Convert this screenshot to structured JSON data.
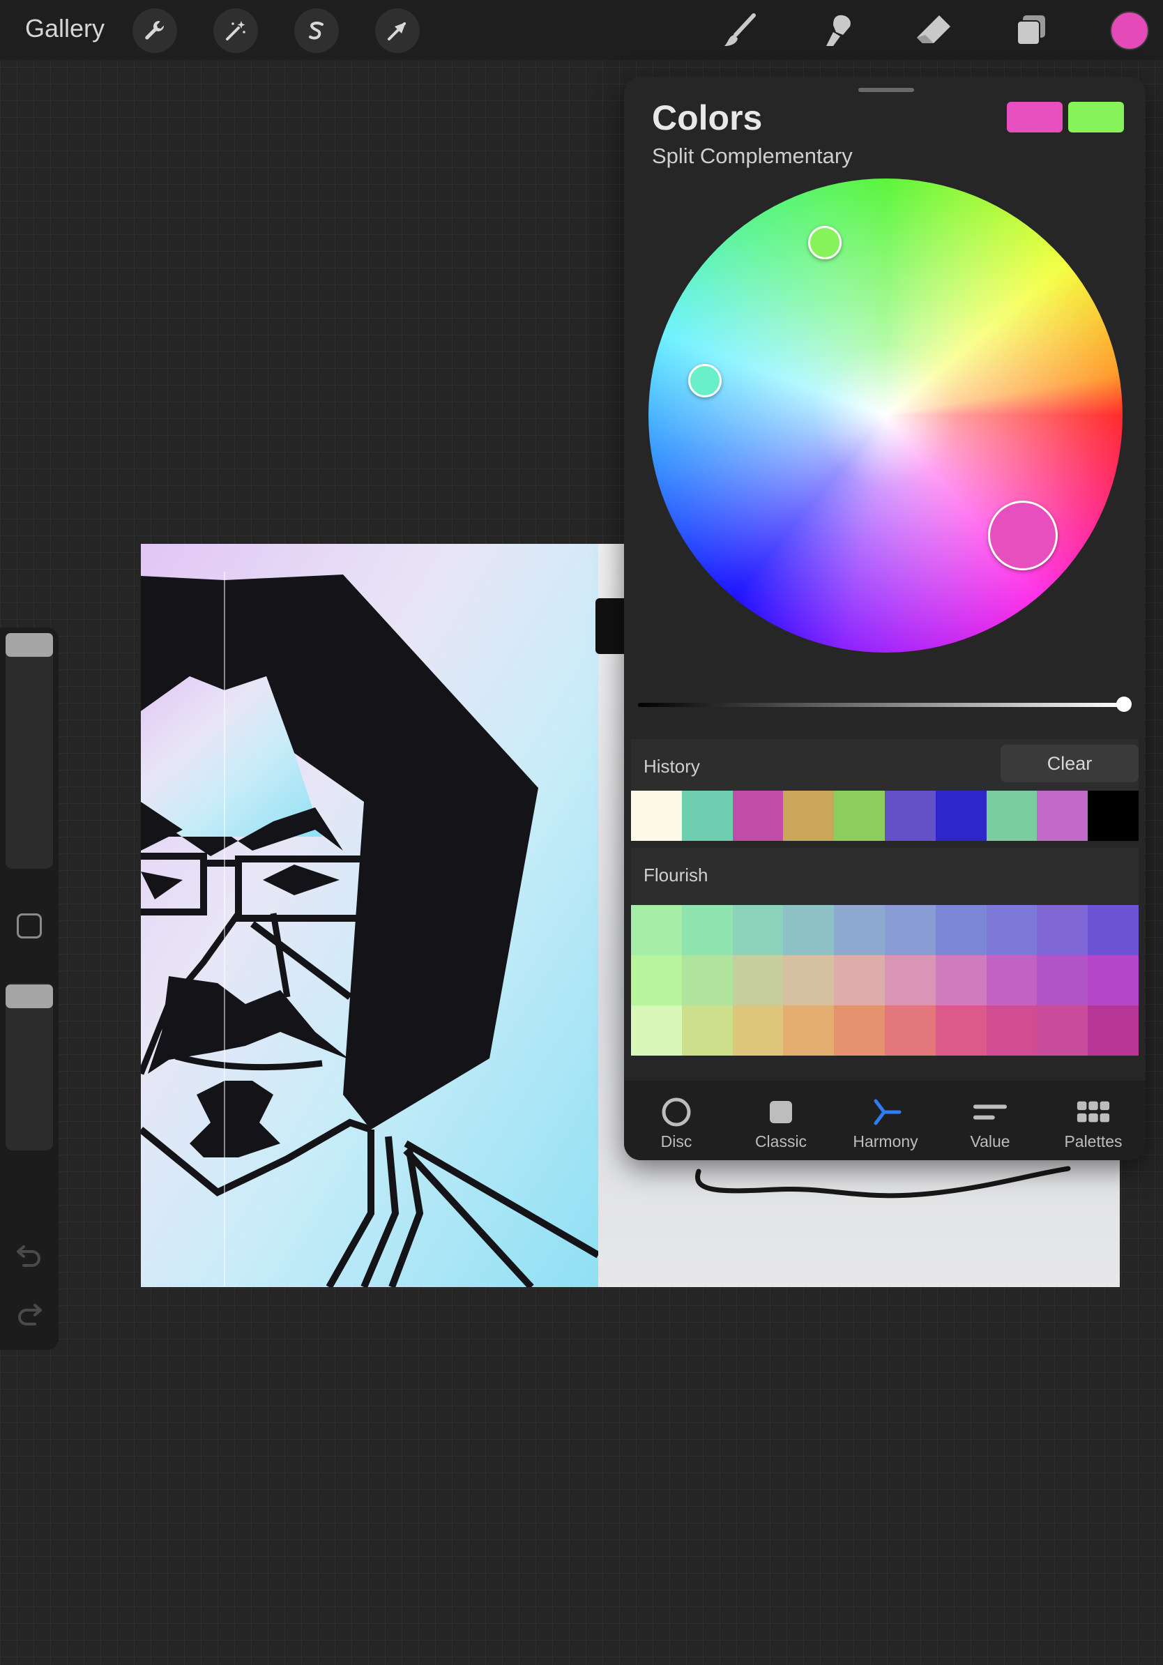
{
  "topbar": {
    "gallery_label": "Gallery",
    "icons": [
      "wrench-icon",
      "magic-wand-icon",
      "selection-s-icon",
      "arrow-transform-icon"
    ],
    "tools": [
      "brush-icon",
      "smudge-icon",
      "eraser-icon",
      "layers-icon"
    ],
    "current_color": "#e44ab8"
  },
  "sidebar": {
    "size_slider_level": 0.0,
    "opacity_slider_level": 0.0
  },
  "colors_panel": {
    "title": "Colors",
    "harmony_mode": "Split Complementary",
    "primary_color": "#e84fbe",
    "secondary_color": "#86f35a",
    "harmony_points": [
      "#e84fbe",
      "#86f35a",
      "#69f0c8"
    ],
    "brightness_level": 1.0,
    "history": {
      "label": "History",
      "clear_label": "Clear",
      "colors": [
        "#fcf9e6",
        "#6dcfb0",
        "#c04ea9",
        "#c9a65a",
        "#8dcd5b",
        "#6451c8",
        "#2d26c8",
        "#79cda0",
        "#c26ac9",
        "#000000"
      ]
    },
    "palette": {
      "label": "Flourish",
      "rows": [
        [
          "#a6eea8",
          "#90e4b0",
          "#8dd2ba",
          "#8ec2c6",
          "#8eaad0",
          "#8a9cd4",
          "#7d87d8",
          "#7c79d8",
          "#7f68d6",
          "#6d54d4"
        ],
        [
          "#b8f49c",
          "#b0e49c",
          "#c6cd9e",
          "#d6c0a2",
          "#dcadab",
          "#d995b5",
          "#cf7bbe",
          "#c262c5",
          "#b154c8",
          "#b447c9"
        ],
        [
          "#d9f7b8",
          "#cedf8c",
          "#ddc57a",
          "#e3ae70",
          "#e5926e",
          "#e2787c",
          "#dc5a8a",
          "#d24c92",
          "#c94b9c",
          "#b83796"
        ]
      ]
    },
    "tabs": [
      {
        "label": "Disc",
        "icon": "disc-icon",
        "active": false
      },
      {
        "label": "Classic",
        "icon": "classic-icon",
        "active": false
      },
      {
        "label": "Harmony",
        "icon": "harmony-icon",
        "active": true
      },
      {
        "label": "Value",
        "icon": "value-icon",
        "active": false
      },
      {
        "label": "Palettes",
        "icon": "palettes-icon",
        "active": false
      }
    ],
    "active_tab_color": "#2f7cf6"
  }
}
